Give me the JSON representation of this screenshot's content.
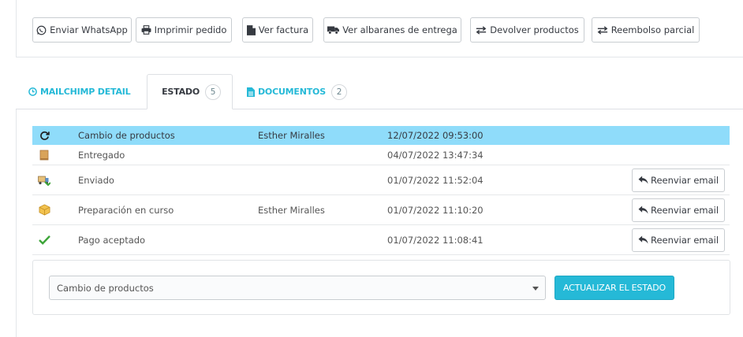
{
  "toolbar": {
    "buttons": [
      {
        "label": "Enviar WhatsApp",
        "icon": "whatsapp-icon"
      },
      {
        "label": "Imprimir pedido",
        "icon": "print-icon"
      },
      {
        "label": "Ver factura",
        "icon": "file-icon"
      },
      {
        "label": "Ver albaranes de entrega",
        "icon": "truck-icon"
      },
      {
        "label": "Devolver productos",
        "icon": "exchange-icon"
      },
      {
        "label": "Reembolso parcial",
        "icon": "exchange-icon"
      }
    ]
  },
  "tabs": [
    {
      "label": "MAILCHIMP DETAIL",
      "icon": "clock-icon",
      "count": ""
    },
    {
      "label": "ESTADO",
      "icon": "clock-icon",
      "count": "5"
    },
    {
      "label": "DOCUMENTOS",
      "icon": "document-icon",
      "count": "2"
    }
  ],
  "history": [
    {
      "status": "Cambio de productos",
      "employee": "Esther Miralles",
      "date": "12/07/2022 09:53:00",
      "icon": "refresh-icon",
      "resend": ""
    },
    {
      "status": "Entregado",
      "employee": "",
      "date": "04/07/2022 13:47:34",
      "icon": "box-icon",
      "resend": ""
    },
    {
      "status": "Enviado",
      "employee": "",
      "date": "01/07/2022 11:52:04",
      "icon": "delivery-truck-icon",
      "resend": "Reenviar email"
    },
    {
      "status": "Preparación en curso",
      "employee": "Esther Miralles",
      "date": "01/07/2022 11:10:20",
      "icon": "package-icon",
      "resend": "Reenviar email"
    },
    {
      "status": "Pago aceptado",
      "employee": "",
      "date": "01/07/2022 11:08:41",
      "icon": "check-icon",
      "resend": "Reenviar email"
    }
  ],
  "update": {
    "selected_state": "Cambio de productos",
    "button_label": "ACTUALIZAR EL ESTADO"
  },
  "colors": {
    "accent": "#25b9d7",
    "current_row": "#8fdcfa"
  }
}
